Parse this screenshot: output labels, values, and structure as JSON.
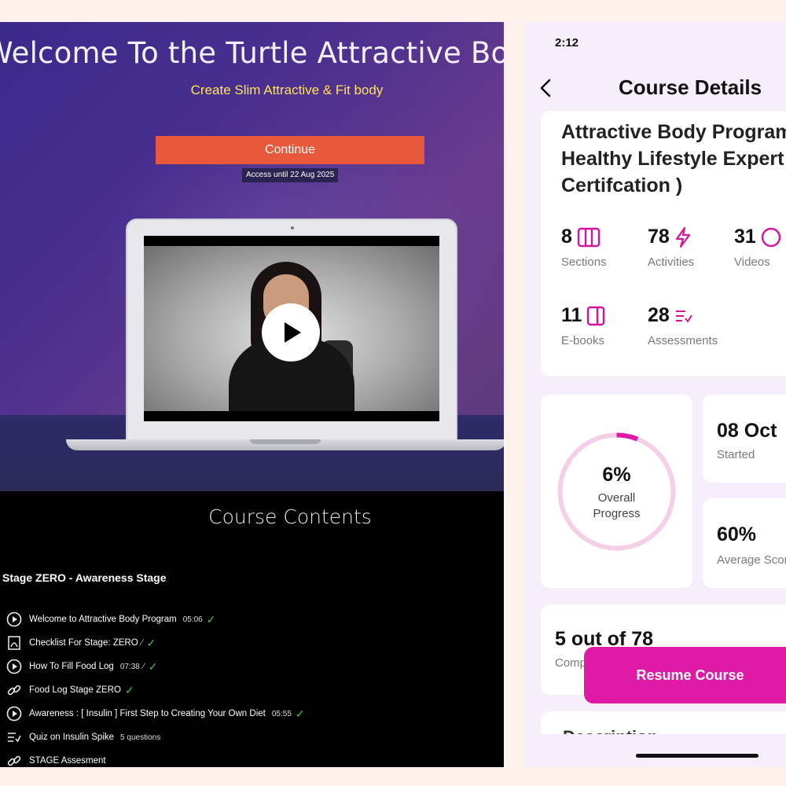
{
  "left_site": {
    "hero_title": "Welcome To the Turtle Attractive Body BOOTCAMP",
    "hero_subtitle": "Create Slim Attractive & Fit body",
    "continue_label": "Continue",
    "access_note": "Access until 22 Aug 2025",
    "contents_title": "Course Contents",
    "stage_title": "Stage ZERO - Awareness Stage",
    "lessons": [
      {
        "icon": "play-circle-icon",
        "title": "Welcome to Attractive Body Program",
        "meta": "05:06",
        "attachment": false,
        "completed": true
      },
      {
        "icon": "pdf-icon",
        "title": "Checklist For Stage: ZERO",
        "meta": "",
        "attachment": true,
        "completed": true
      },
      {
        "icon": "play-circle-icon",
        "title": "How To Fill Food Log",
        "meta": "07:38",
        "attachment": true,
        "completed": true
      },
      {
        "icon": "link-icon",
        "title": "Food Log Stage ZERO",
        "meta": "",
        "attachment": false,
        "completed": true
      },
      {
        "icon": "play-circle-icon",
        "title": "Awareness : [ Insulin ] First Step to Creating Your Own Diet",
        "meta": "05:55",
        "attachment": false,
        "completed": true
      },
      {
        "icon": "quiz-icon",
        "title": "Quiz on Insulin Spike",
        "meta": "5 questions",
        "attachment": false,
        "completed": false
      },
      {
        "icon": "link-icon",
        "title": "STAGE Assesment",
        "meta": "",
        "attachment": false,
        "completed": false
      }
    ]
  },
  "app": {
    "status_time": "2:12",
    "header_title": "Course Details",
    "course_title": "Attractive Body Program ( Healthy Lifestyle Expert Certifcation )",
    "stats": [
      {
        "value": "8",
        "label": "Sections",
        "icon": "sections-icon"
      },
      {
        "value": "78",
        "label": "Activities",
        "icon": "lightning-icon"
      },
      {
        "value": "31",
        "label": "Videos",
        "icon": "video-icon"
      },
      {
        "value": "11",
        "label": "E-books",
        "icon": "ebook-icon"
      },
      {
        "value": "28",
        "label": "Assessments",
        "icon": "assessment-icon"
      }
    ],
    "progress": {
      "value": "6%",
      "label": "Overall Progress",
      "fraction": 0.06
    },
    "started": {
      "value": "08 Oct",
      "label": "Started"
    },
    "average_score": {
      "value": "60%",
      "label": "Average Score"
    },
    "completed": {
      "value": "5 out of 78",
      "label": "Completed"
    },
    "resume_label": "Resume Course",
    "description_title": "Description",
    "accent_color": "#de1aa6"
  }
}
